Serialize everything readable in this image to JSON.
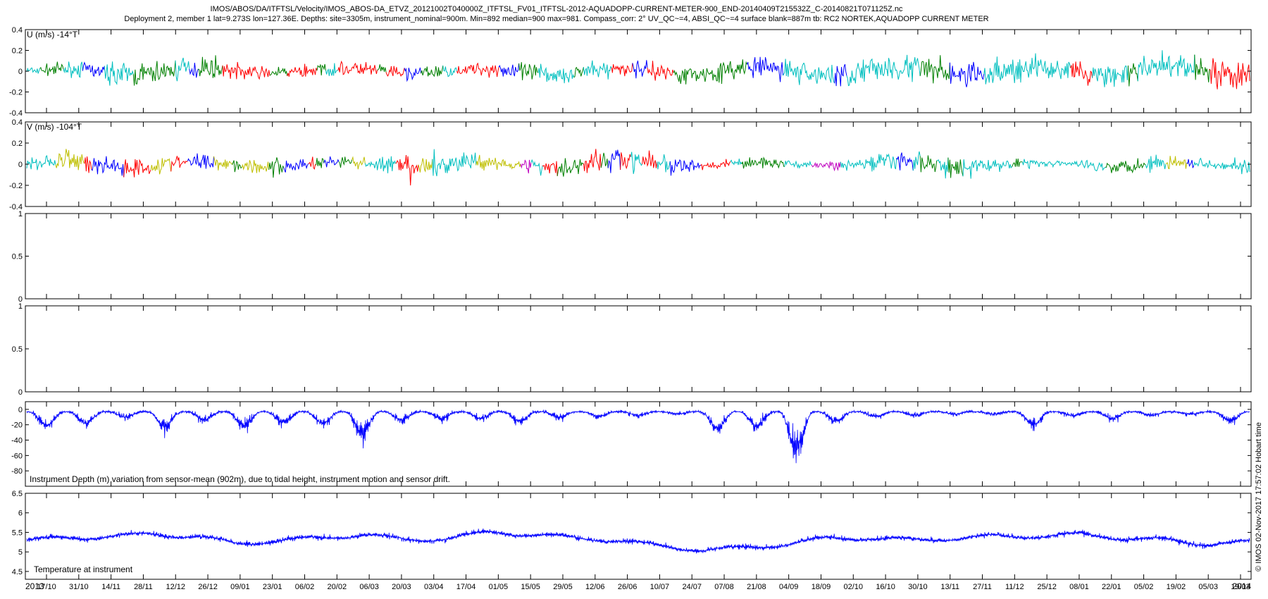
{
  "title_line1": "IMOS/ABOS/DA/ITFTSL/Velocity/IMOS_ABOS-DA_ETVZ_20121002T040000Z_ITFTSL_FV01_ITFTSL-2012-AQUADOPP-CURRENT-METER-900_END-20140409T215532Z_C-20140821T071125Z.nc",
  "title_line2": "Deployment 2, member 1 lat=9.273S lon=127.36E. Depths: site=3305m, instrument_nominal=900m. Min=892 median=900 max=981. Compass_corr: 2° UV_QC~=4, ABSI_QC~=4 surface blank=887m tb: RC2 NORTEK,AQUADOPP CURRENT METER",
  "credit": "© IMOS 02-Nov-2017 17:57:02 Hobart time",
  "colors": {
    "red": "#ff0000",
    "blue": "#0000ff",
    "green": "#008000",
    "cyan": "#00bfbf",
    "magenta": "#bf00bf",
    "yellow": "#bfbf00",
    "black": "#000000"
  },
  "chart_data": [
    {
      "id": "u",
      "type": "line",
      "label": "U (m/s) -14°T",
      "ylim": [
        -0.4,
        0.4
      ],
      "yticks": [
        -0.4,
        -0.2,
        0,
        0.2,
        0.4
      ],
      "ytick_labels": [
        "-0.4",
        "-0.2",
        "0",
        "0.2",
        "0.4"
      ],
      "series_colors": [
        "red",
        "blue",
        "green",
        "cyan"
      ],
      "envelope": [
        0.06,
        0.1,
        0.16,
        0.17,
        0.14,
        0.08,
        0.1,
        0.12,
        0.1,
        0.08,
        0.12,
        0.14,
        0.11,
        0.12,
        0.14,
        0.16,
        0.18,
        0.2,
        0.22,
        0.18,
        0.2,
        0.16,
        0.2,
        0.2,
        0.2,
        0.22
      ],
      "noise_amp": 0.1
    },
    {
      "id": "v",
      "type": "line",
      "label": "V (m/s) -104°T",
      "ylim": [
        -0.4,
        0.4
      ],
      "yticks": [
        -0.4,
        -0.2,
        0,
        0.2,
        0.4
      ],
      "ytick_labels": [
        "-0.4",
        "-0.2",
        "0",
        "0.2",
        "0.4"
      ],
      "series_colors": [
        "cyan",
        "red",
        "blue",
        "green",
        "magenta",
        "yellow"
      ],
      "envelope": [
        0.1,
        0.18,
        0.15,
        0.12,
        0.1,
        0.12,
        0.12,
        0.08,
        0.2,
        0.12,
        0.08,
        0.14,
        0.2,
        0.16,
        0.06,
        0.08,
        0.04,
        0.1,
        0.16,
        0.14,
        0.1,
        0.04,
        0.08,
        0.12,
        0.06,
        0.1
      ],
      "noise_amp": 0.14
    },
    {
      "id": "empty1",
      "type": "line",
      "label": "",
      "ylim": [
        0,
        1
      ],
      "yticks": [
        0,
        0.5,
        1
      ],
      "ytick_labels": [
        "0",
        "0.5",
        "1"
      ],
      "series_colors": []
    },
    {
      "id": "empty2",
      "type": "line",
      "label": "",
      "ylim": [
        0,
        1
      ],
      "yticks": [
        0,
        0.5,
        1
      ],
      "ytick_labels": [
        "0",
        "0.5",
        "1"
      ],
      "series_colors": []
    },
    {
      "id": "depth",
      "type": "line",
      "label": "Instrument Depth (m) variation from sensor-mean (902m), due to tidal height, instrument motion and sensor drift.",
      "ylim": [
        -100,
        10
      ],
      "yticks": [
        -80,
        -60,
        -40,
        -20,
        0
      ],
      "ytick_labels": [
        "-80",
        "-60",
        "-40",
        "-20",
        "0"
      ],
      "series_colors": [
        "blue"
      ],
      "dips": [
        -30,
        -25,
        -12,
        -30,
        -18,
        -30,
        -22,
        -25,
        -45,
        -18,
        -15,
        -15,
        -20,
        -12,
        -10,
        -8,
        -5,
        -35,
        -30,
        -75,
        -20,
        -10,
        -8,
        -5,
        -5,
        -28,
        -8,
        -15,
        -8,
        -5,
        -20
      ],
      "noise_amp": 5
    },
    {
      "id": "temp",
      "type": "line",
      "label": "Temperature at instrument",
      "ylim": [
        4.3,
        6.5
      ],
      "yticks": [
        4.5,
        5,
        5.5,
        6,
        6.5
      ],
      "ytick_labels": [
        "4.5",
        "5",
        "5.5",
        "6",
        "6.5"
      ],
      "series_colors": [
        "blue"
      ],
      "baseline": [
        5.3,
        5.35,
        5.4,
        5.45,
        5.4,
        5.2,
        5.3,
        5.35,
        5.45,
        5.3,
        5.35,
        5.5,
        5.45,
        5.35,
        5.3,
        5.15,
        5.05,
        5.1,
        5.2,
        5.35,
        5.35,
        5.3,
        5.35,
        5.4,
        5.4,
        5.45,
        5.35,
        5.3,
        5.2,
        5.25
      ],
      "noise_amp": 0.12
    }
  ],
  "x_axis": {
    "ticks": [
      "17/10",
      "31/10",
      "14/11",
      "28/11",
      "12/12",
      "26/12",
      "09/01",
      "23/01",
      "06/02",
      "20/02",
      "06/03",
      "20/03",
      "03/04",
      "17/04",
      "01/05",
      "15/05",
      "29/05",
      "12/06",
      "26/06",
      "10/07",
      "24/07",
      "07/08",
      "21/08",
      "04/09",
      "18/09",
      "02/10",
      "16/10",
      "30/10",
      "13/11",
      "27/11",
      "11/12",
      "25/12",
      "08/01",
      "22/01",
      "05/02",
      "19/02",
      "05/03",
      "19/03"
    ],
    "start_year_label": "2013",
    "end_year_label": "2014"
  }
}
